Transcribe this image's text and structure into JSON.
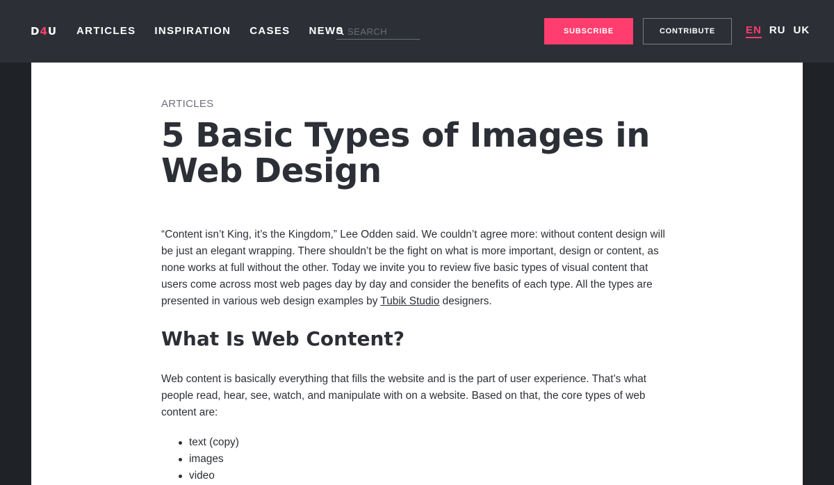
{
  "header": {
    "logo": {
      "part1": "D",
      "part2": "4",
      "part3": "U"
    },
    "nav": [
      {
        "label": "ARTICLES"
      },
      {
        "label": "INSPIRATION"
      },
      {
        "label": "CASES"
      },
      {
        "label": "NEWS"
      }
    ],
    "search": {
      "placeholder": "SEARCH",
      "value": ""
    },
    "subscribe_label": "SUBSCRIBE",
    "contribute_label": "CONTRIBUTE",
    "languages": [
      {
        "label": "EN",
        "active": true
      },
      {
        "label": "RU",
        "active": false
      },
      {
        "label": "UK",
        "active": false
      }
    ]
  },
  "article": {
    "category": "ARTICLES",
    "title": "5 Basic Types of Images in Web Design",
    "intro_before_link": "“Content isn’t King, it’s the Kingdom,” Lee Odden said. We couldn’t agree more: without content design will be just an elegant wrapping. There shouldn’t be the fight on what is more important, design or content, as none works at full without the other. Today we invite you to review five basic types of visual content that users come across most web pages day by day and consider the benefits of each type. All the types are presented in various web design examples by ",
    "intro_link": "Tubik Studio",
    "intro_after_link": " designers.",
    "section_heading": "What Is Web Content?",
    "section_text": "Web content is basically everything that fills the website and is the part of user experience. That’s what people read, hear, see, watch, and manipulate with on a website. Based on that, the core types of web content are:",
    "list": [
      "text (copy)",
      "images",
      "video"
    ]
  },
  "colors": {
    "header_bg": "#2c2f36",
    "page_bg": "#1f2227",
    "accent": "#ff3d6e",
    "text": "#2c2f36"
  }
}
